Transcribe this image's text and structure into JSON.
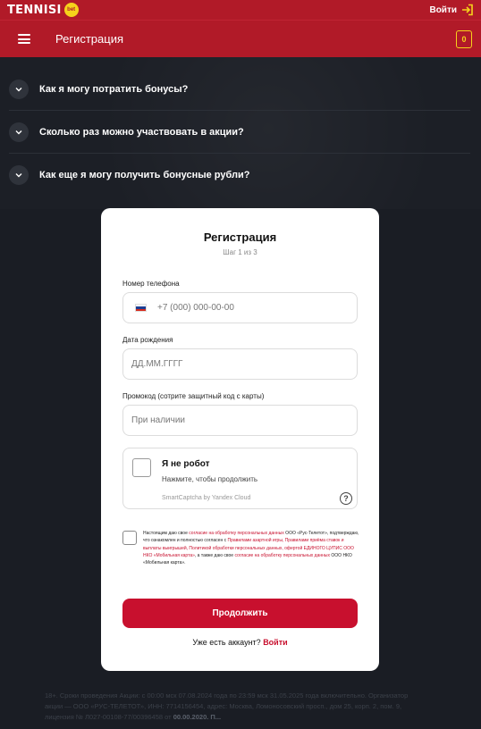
{
  "topbar": {
    "logo_text": "TENNISI",
    "logo_badge": "bet",
    "login_label": "Войти",
    "login_icon": "login-arrow-icon",
    "accent_color": "#f6d21b",
    "brand_color": "#b11a28"
  },
  "header": {
    "menu_icon": "hamburger-menu-icon",
    "title": "Регистрация",
    "wallet_count": "0"
  },
  "faq": {
    "items": [
      {
        "question": "Как я могу потратить бонусы?"
      },
      {
        "question": "Сколько раз можно участвовать в акции?"
      },
      {
        "question": "Как еще я могу получить бонусные рубли?"
      }
    ]
  },
  "form": {
    "title": "Регистрация",
    "step": "Шаг 1 из 3",
    "phone_label": "Номер телефона",
    "phone_placeholder": "+7 (000) 000-00-00",
    "birth_label": "Дата рождения",
    "birth_placeholder": "ДД.ММ.ГГГГ",
    "promo_label": "Промокод (сотрите защитный код с карты)",
    "promo_placeholder": "При наличии",
    "captcha_title": "Я не робот",
    "captcha_sub": "Нажмите, чтобы продолжить",
    "captcha_brand": "SmartCaptcha by Yandex Cloud",
    "captcha_help": "?",
    "consent": {
      "t1": "Настоящим даю свое ",
      "l1": "согласие на обработку персональных данных",
      "t2": " ООО «Рус-Телетот», подтверждаю, что ознакомлен и полностью согласен с ",
      "l2": "Правилами азартной игры, Правилами приёма ставок и выплаты выигрышей, Политикой обработки персональных данных, офертой ЕДИНОГО ЦУПИС ООО НКО «Мобильная карта»",
      "t3": ", а также даю свое ",
      "l3": "согласие на обработку персональных данных",
      "t4": " ООО НКО «Мобильная карта»."
    },
    "submit_label": "Продолжить",
    "have_account": "Уже есть аккаунт?",
    "login_link": "Войти",
    "accent_color": "#c8102e"
  },
  "footer": {
    "text": "18+. Сроки проведения Акции: с 00:00 мск 07.08.2024 года по 23:59 мск 31.05.2025 года включительно. Организатор акции — ООО «РУС-ТЕЛЕТОТ», ИНН: 7714156454, адрес: Москва, Ломоносовский просп., дом 25, корп. 2, пом. 9, лицензия № Л027-00108-77/00396458 от",
    "text_end": "00.00.2020. П..."
  }
}
